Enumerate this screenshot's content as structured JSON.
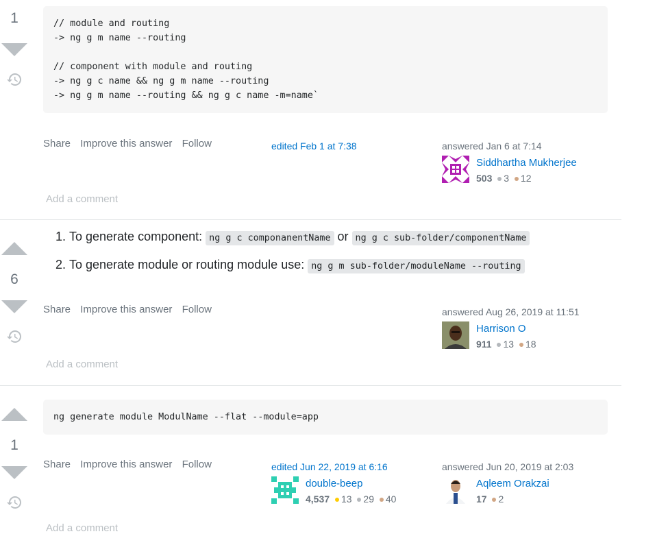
{
  "answers": [
    {
      "votes": "1",
      "code": "// module and routing\n-> ng g m name --routing\n\n// component with module and routing\n-> ng g c name && ng g m name --routing\n-> ng g m name --routing && ng g c name -m=name`",
      "menu": {
        "share": "Share",
        "improve": "Improve this answer",
        "follow": "Follow"
      },
      "edited": "edited Feb 1 at 7:38",
      "answered": "answered Jan 6 at 7:14",
      "user": {
        "name": "Siddhartha Mukherjee",
        "rep": "503",
        "silver": "3",
        "bronze": "12"
      },
      "add_comment": "Add a comment"
    },
    {
      "votes": "6",
      "steps": [
        {
          "text": "To generate component: ",
          "code1": "ng g c componanentName",
          "or": " or ",
          "code2": "ng g c sub-folder/componentName"
        },
        {
          "text": "To generate module or routing module use: ",
          "code1": "ng g m sub-folder/moduleName --routing"
        }
      ],
      "menu": {
        "share": "Share",
        "improve": "Improve this answer",
        "follow": "Follow"
      },
      "answered": "answered Aug 26, 2019 at 11:51",
      "user": {
        "name": "Harrison O",
        "rep": "911",
        "silver": "13",
        "bronze": "18"
      },
      "add_comment": "Add a comment"
    },
    {
      "votes": "1",
      "code": "ng generate module ModulName --flat --module=app",
      "menu": {
        "share": "Share",
        "improve": "Improve this answer",
        "follow": "Follow"
      },
      "edited": "edited Jun 22, 2019 at 6:16",
      "editor": {
        "name": "double-beep",
        "rep": "4,537",
        "gold": "13",
        "silver": "29",
        "bronze": "40"
      },
      "answered": "answered Jun 20, 2019 at 2:03",
      "user": {
        "name": "Aqleem Orakzai",
        "rep": "17",
        "bronze": "2"
      },
      "add_comment": "Add a comment"
    }
  ],
  "colors": {
    "link": "#0074cc",
    "muted": "#6a737c",
    "arrow": "#bbc0c4",
    "code_bg": "#f6f6f6"
  },
  "icons": {
    "history": "history-icon",
    "vote_up": "upvote-arrow-icon",
    "vote_down": "downvote-arrow-icon"
  }
}
